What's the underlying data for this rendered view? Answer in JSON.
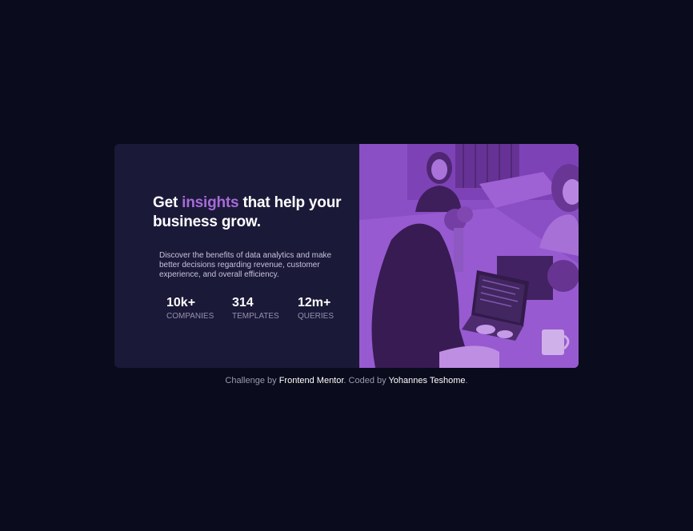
{
  "card": {
    "headline": {
      "before": "Get ",
      "accent": "insights",
      "after": " that help your business grow."
    },
    "description": "Discover the benefits of data analytics and make better decisions regarding revenue, customer experience, and overall efficiency.",
    "stats": [
      {
        "value": "10k+",
        "label": "Companies"
      },
      {
        "value": "314",
        "label": "Templates"
      },
      {
        "value": "12m+",
        "label": "Queries"
      }
    ]
  },
  "attribution": {
    "prefix": "Challenge by ",
    "link1": "Frontend Mentor",
    "middle": ". Coded by ",
    "link2": "Yohannes Teshome",
    "suffix": "."
  },
  "colors": {
    "page_background": "#0a0b1c",
    "card_background": "#1b1938",
    "accent": "#a66bd8",
    "image_overlay": "#8d4ac9"
  },
  "image": {
    "icon": "team-meeting-photo"
  }
}
